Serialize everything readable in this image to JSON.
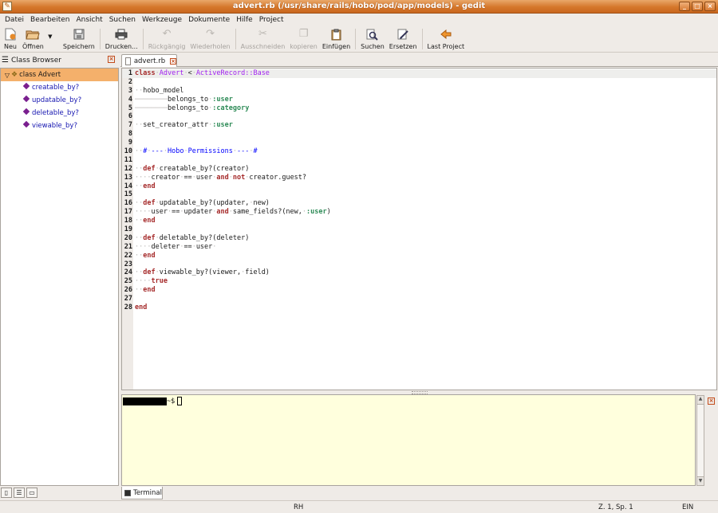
{
  "window": {
    "title": "advert.rb (/usr/share/rails/hobo/pod/app/models) - gedit",
    "buttons": [
      "_",
      "□",
      "×"
    ]
  },
  "menubar": [
    "Datei",
    "Bearbeiten",
    "Ansicht",
    "Suchen",
    "Werkzeuge",
    "Dokumente",
    "Hilfe",
    "Project"
  ],
  "toolbar": {
    "new": "Neu",
    "open": "Öffnen",
    "save": "Speichern",
    "print": "Drucken...",
    "undo": "Rückgängig",
    "redo": "Wiederholen",
    "cut": "Ausschneiden",
    "copy": "kopieren",
    "paste": "Einfügen",
    "find": "Suchen",
    "replace": "Ersetzen",
    "last_project": "Last Project"
  },
  "side_panel": {
    "title": "Class Browser",
    "class_node": "class Advert",
    "methods": [
      "creatable_by?",
      "updatable_by?",
      "deletable_by?",
      "viewable_by?"
    ]
  },
  "document": {
    "tab_label": "advert.rb",
    "line_numbers": [
      "1",
      "2",
      "3",
      "4",
      "5",
      "6",
      "7",
      "8",
      "9",
      "10",
      "11",
      "12",
      "13",
      "14",
      "15",
      "16",
      "17",
      "18",
      "19",
      "20",
      "21",
      "22",
      "23",
      "24",
      "25",
      "26",
      "27",
      "28"
    ]
  },
  "bottom_panel": {
    "prompt": "~$",
    "tab_label": "Terminal"
  },
  "statusbar": {
    "mode": "RH",
    "position": "Z. 1, Sp. 1",
    "insert_mode": "EIN"
  },
  "colors": {
    "titlebar": "#d5772b",
    "selection": "#f4b06b",
    "terminal_bg": "#ffffdd",
    "keyword": "#a52a2a",
    "constant": "#a020f0",
    "symbol": "#2e8b57",
    "comment": "#0000ff"
  }
}
